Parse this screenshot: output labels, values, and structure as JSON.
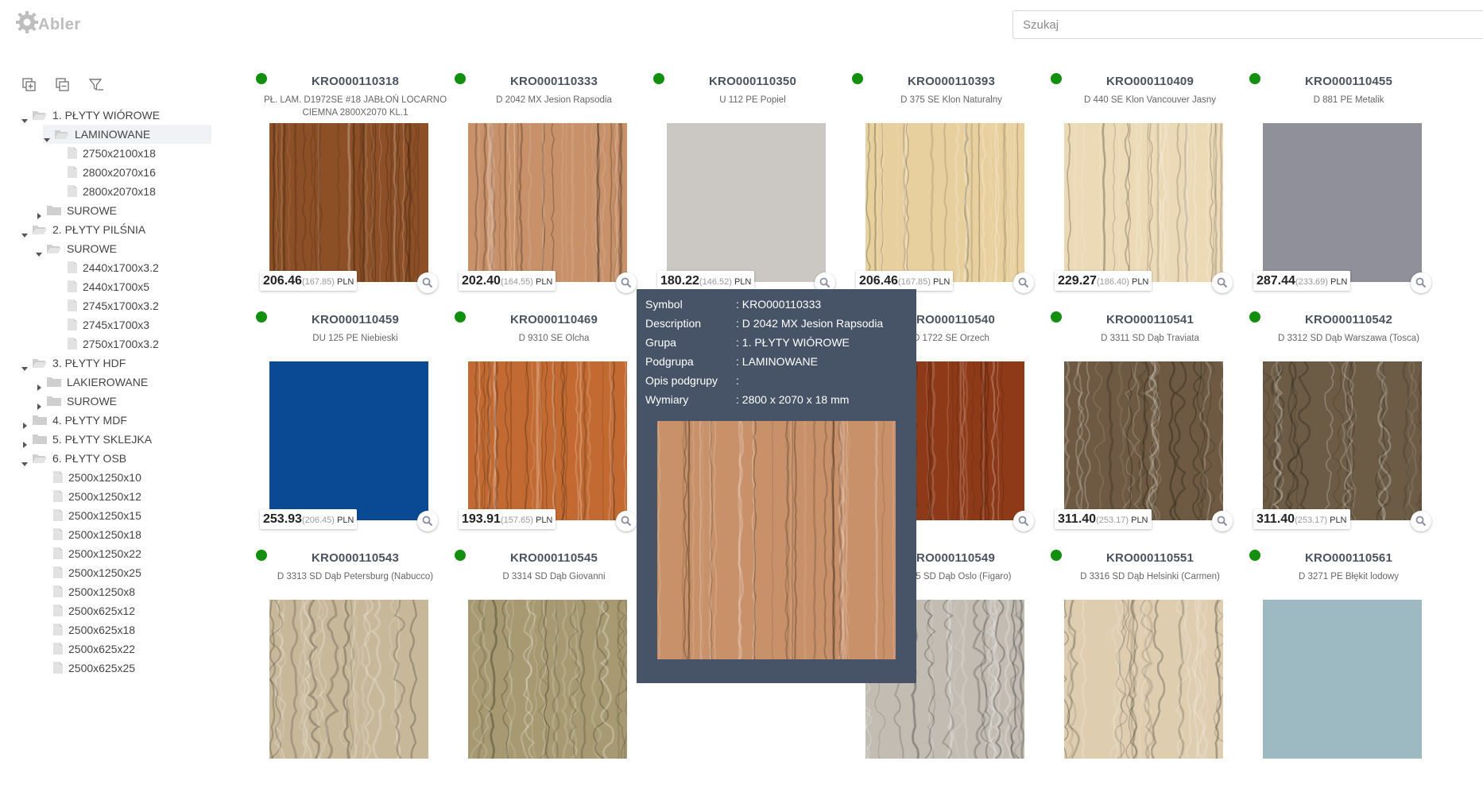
{
  "app": {
    "logo_text": "Abler"
  },
  "search": {
    "placeholder": "Szukaj",
    "value": ""
  },
  "tree_toolbar": {
    "icons": [
      "expand-all-icon",
      "collapse-all-icon",
      "clear-filter-icon"
    ]
  },
  "tree": [
    {
      "label": "1. PŁYTY WIÓROWE",
      "level": 0,
      "type": "folder",
      "open": true
    },
    {
      "label": "LAMINOWANE",
      "level": 1,
      "type": "folder",
      "open": true,
      "selected": true
    },
    {
      "label": "2750x2100x18",
      "level": 2,
      "type": "file"
    },
    {
      "label": "2800x2070x16",
      "level": 2,
      "type": "file"
    },
    {
      "label": "2800x2070x18",
      "level": 2,
      "type": "file"
    },
    {
      "label": "SUROWE",
      "level": 1,
      "type": "folder",
      "open": false
    },
    {
      "label": "2. PŁYTY PILŚNIA",
      "level": 0,
      "type": "folder",
      "open": true
    },
    {
      "label": "SUROWE",
      "level": 1,
      "type": "folder",
      "open": true
    },
    {
      "label": "2440x1700x3.2",
      "level": 2,
      "type": "file"
    },
    {
      "label": "2440x1700x5",
      "level": 2,
      "type": "file"
    },
    {
      "label": "2745x1700x3.2",
      "level": 2,
      "type": "file"
    },
    {
      "label": "2745x1700x3",
      "level": 2,
      "type": "file"
    },
    {
      "label": "2750x1700x3.2",
      "level": 2,
      "type": "file"
    },
    {
      "label": "3. PŁYTY HDF",
      "level": 0,
      "type": "folder",
      "open": true
    },
    {
      "label": "LAKIEROWANE",
      "level": 1,
      "type": "folder",
      "open": false
    },
    {
      "label": "SUROWE",
      "level": 1,
      "type": "folder",
      "open": false
    },
    {
      "label": "4. PŁYTY MDF",
      "level": 0,
      "type": "folder",
      "open": false
    },
    {
      "label": "5. PŁYTY SKLEJKA",
      "level": 0,
      "type": "folder",
      "open": false
    },
    {
      "label": "6. PŁYTY OSB",
      "level": 0,
      "type": "folder",
      "open": true
    },
    {
      "label": "2500x1250x10",
      "level": 1,
      "type": "file"
    },
    {
      "label": "2500x1250x12",
      "level": 1,
      "type": "file"
    },
    {
      "label": "2500x1250x15",
      "level": 1,
      "type": "file"
    },
    {
      "label": "2500x1250x18",
      "level": 1,
      "type": "file"
    },
    {
      "label": "2500x1250x22",
      "level": 1,
      "type": "file"
    },
    {
      "label": "2500x1250x25",
      "level": 1,
      "type": "file"
    },
    {
      "label": "2500x1250x8",
      "level": 1,
      "type": "file"
    },
    {
      "label": "2500x625x12",
      "level": 1,
      "type": "file"
    },
    {
      "label": "2500x625x18",
      "level": 1,
      "type": "file"
    },
    {
      "label": "2500x625x22",
      "level": 1,
      "type": "file"
    },
    {
      "label": "2500x625x25",
      "level": 1,
      "type": "file"
    }
  ],
  "products": [
    {
      "symbol": "KRO000110318",
      "description": "PŁ. LAM. D1972SE #18 JABŁOŃ LOCARNO CIEMNA 2800X2070 KL.1",
      "price": "206.46",
      "net": "(167.85)",
      "currency": "PLN",
      "swatch": "#8c4f26",
      "texture": "grain"
    },
    {
      "symbol": "KRO000110333",
      "description": "D 2042 MX Jesion Rapsodia",
      "price": "202.40",
      "net": "(164.55)",
      "currency": "PLN",
      "swatch": "#c8916a",
      "texture": "grain"
    },
    {
      "symbol": "KRO000110350",
      "description": "U 112 PE Popiel",
      "price": "180.22",
      "net": "(146.52)",
      "currency": "PLN",
      "swatch": "#cbc7c2",
      "texture": "plain"
    },
    {
      "symbol": "KRO000110393",
      "description": "D 375 SE Klon Naturalny",
      "price": "206.46",
      "net": "(167.85)",
      "currency": "PLN",
      "swatch": "#e8cf9e",
      "texture": "grain"
    },
    {
      "symbol": "KRO000110409",
      "description": "D 440 SE Klon Vancouver Jasny",
      "price": "229.27",
      "net": "(186.40)",
      "currency": "PLN",
      "swatch": "#ecd9b6",
      "texture": "grain"
    },
    {
      "symbol": "KRO000110455",
      "description": "D 881 PE Metalik",
      "price": "287.44",
      "net": "(233.69)",
      "currency": "PLN",
      "swatch": "#8f9099",
      "texture": "plain"
    },
    {
      "symbol": "KRO000110459",
      "description": "DU 125 PE Niebieski",
      "price": "253.93",
      "net": "(206.45)",
      "currency": "PLN",
      "swatch": "#0a4a94",
      "texture": "plain"
    },
    {
      "symbol": "KRO000110469",
      "description": "D 9310 SE Olcha",
      "price": "193.91",
      "net": "(157.65)",
      "currency": "PLN",
      "swatch": "#c26a32",
      "texture": "grain"
    },
    {
      "symbol": "",
      "description": "",
      "price": "",
      "net": "",
      "currency": "",
      "swatch": "#c09070",
      "texture": "hidden"
    },
    {
      "symbol": "KRO000110540",
      "description": "D 1722 SE Orzech",
      "price": "",
      "net": "6.40)",
      "currency": "PLN",
      "swatch": "#8e3a18",
      "texture": "grain"
    },
    {
      "symbol": "KRO000110541",
      "description": "D 3311 SD Dąb Traviata",
      "price": "311.40",
      "net": "(253.17)",
      "currency": "PLN",
      "swatch": "#6e5a42",
      "texture": "oak"
    },
    {
      "symbol": "KRO000110542",
      "description": "D 3312 SD Dąb Warszawa (Tosca)",
      "price": "311.40",
      "net": "(253.17)",
      "currency": "PLN",
      "swatch": "#6c5c45",
      "texture": "oak"
    },
    {
      "symbol": "KRO000110543",
      "description": "D 3313 SD Dąb Petersburg (Nabucco)",
      "price": "",
      "net": "",
      "currency": "",
      "swatch": "#c8b89a",
      "texture": "oak"
    },
    {
      "symbol": "KRO000110545",
      "description": "D 3314 SD Dąb Giovanni",
      "price": "",
      "net": "",
      "currency": "",
      "swatch": "#a79a72",
      "texture": "oak"
    },
    {
      "symbol": "",
      "description": "",
      "price": "",
      "net": "",
      "currency": "",
      "swatch": "#c09070",
      "texture": "hidden"
    },
    {
      "symbol": "KRO000110549",
      "description": "D 3315 SD Dąb Oslo (Figaro)",
      "price": "",
      "net": "",
      "currency": "",
      "swatch": "#c2bcb2",
      "texture": "oak"
    },
    {
      "symbol": "KRO000110551",
      "description": "D 3316 SD Dąb Helsinki (Carmen)",
      "price": "",
      "net": "",
      "currency": "",
      "swatch": "#dfcdb0",
      "texture": "oak"
    },
    {
      "symbol": "KRO000110561",
      "description": "D 3271 PE Błękit lodowy",
      "price": "",
      "net": "",
      "currency": "",
      "swatch": "#9dbac3",
      "texture": "plain"
    }
  ],
  "tooltip": {
    "rows": [
      {
        "key": "Symbol",
        "value": ": KRO000110333"
      },
      {
        "key": "Description",
        "value": ": D 2042 MX Jesion Rapsodia"
      },
      {
        "key": "Grupa",
        "value": ": 1. PŁYTY WIÓROWE"
      },
      {
        "key": "Podgrupa",
        "value": ": LAMINOWANE"
      },
      {
        "key": "Opis podgrupy",
        "value": ":"
      },
      {
        "key": "Wymiary",
        "value": ": 2800 x 2070 x 18 mm"
      }
    ],
    "swatch": "#c8916a"
  },
  "colors": {
    "in_stock": "#138f10",
    "tooltip_bg": "#475467",
    "tree_selected": "#f1f2f6"
  }
}
